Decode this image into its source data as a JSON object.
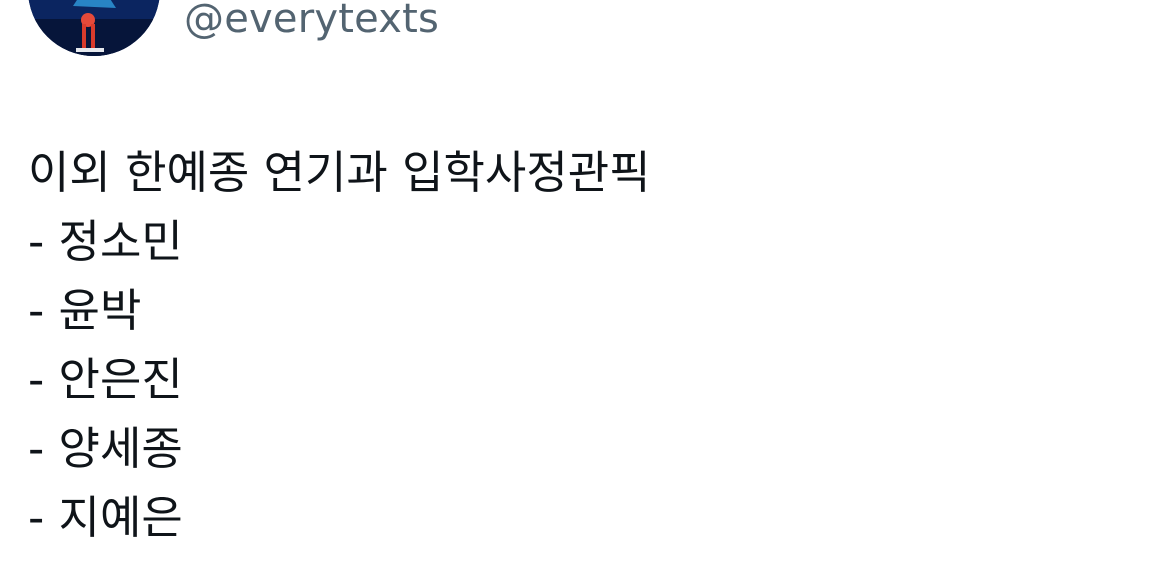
{
  "tweet": {
    "handle": "@everytexts",
    "lines": [
      "이외 한예종 연기과 입학사정관픽",
      "- 정소민",
      "- 윤박",
      "- 안은진",
      "- 양세종",
      "- 지예은"
    ]
  },
  "colors": {
    "handle": "#536471",
    "text": "#0f1419",
    "background": "#ffffff"
  }
}
